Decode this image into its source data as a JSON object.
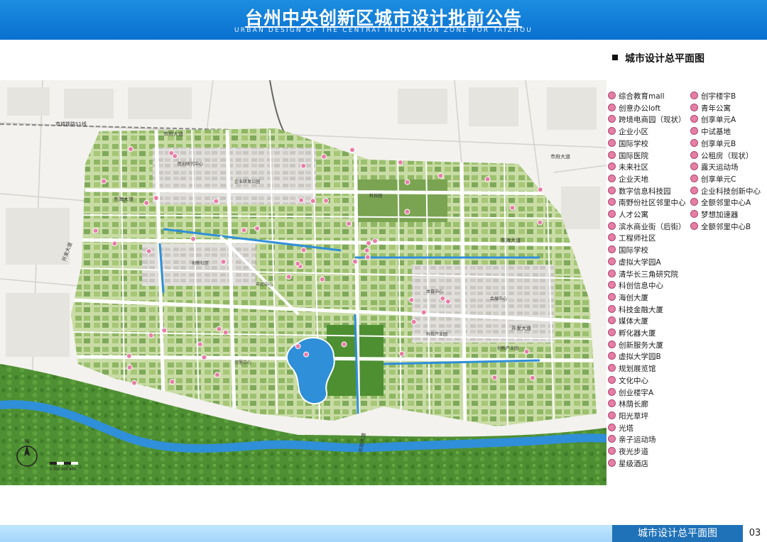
{
  "header": {
    "title": "台州中央创新区城市设计批前公告",
    "subtitle": "URBAN DESIGN OF THE CENTRAI INNOVATION ZONE FOR TAIZHOU"
  },
  "section_title": "城市设计总平面图",
  "map": {
    "road_labels": [
      "市域铁路S1线",
      "市府大道",
      "东海大道",
      "开发大道",
      "东海大道",
      "开发大道",
      "市府大道",
      "市政大道"
    ],
    "annotations": [
      "医创研究中心",
      "企业研发公园",
      "科技园",
      "创新社区",
      "市民中心",
      "体育中心",
      "会展中心",
      "科技产业园",
      "创新产业园",
      "邻里中心"
    ],
    "colors": {
      "block_green": "#a7c777",
      "block_dark_green": "#6f9a4c",
      "park": "#4d8f31",
      "water": "#2f8fd8",
      "road": "#ffffff",
      "background": "#f3f2ee",
      "marker": "#e77ea6"
    },
    "marker_count": 62
  },
  "legend": {
    "col1": [
      "综合教育mall",
      "创意办公loft",
      "跨境电商园（现状）",
      "企业小区",
      "国际学校",
      "国际医院",
      "未来社区",
      "企业天地",
      "数字信息科技园",
      "南野份社区邻里中心",
      "人才公寓",
      "滨水商业街（后街）",
      "工程师社区",
      "国际学校",
      "虚拟大学园A",
      "清华长三角研究院",
      "科创信息中心",
      "海创大厦",
      "科技金融大厦",
      "媒体大厦",
      "孵化器大厦",
      "创新服务大厦",
      "虚拟大学园B",
      "规划展览馆",
      "文化中心",
      "创业楼宇A",
      "林荫长廊",
      "阳光草坪",
      "光塔",
      "亲子运动场",
      "夜光步道",
      "星级酒店"
    ],
    "col2": [
      "创宇楼宇B",
      "青年公寓",
      "创享单元A",
      "中试基地",
      "创享单元B",
      "公租房（现状）",
      "露天运动场",
      "创享单元C",
      "企业科技创新中心",
      "全额邻里中心A",
      "梦想加速器",
      "全额邻里中心B"
    ]
  },
  "compass": {
    "label": "N"
  },
  "scale_bar": {
    "label": "0 100 200 400"
  },
  "footer": {
    "title": "城市设计总平面图",
    "page_number": "03"
  }
}
